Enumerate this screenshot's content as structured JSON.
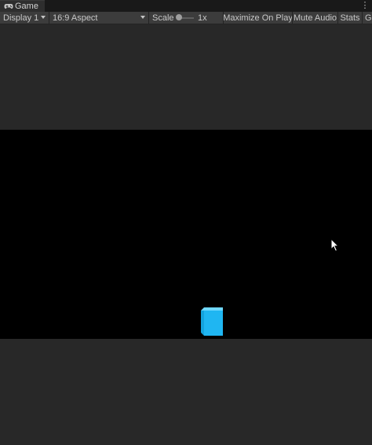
{
  "tab": {
    "label": "Game",
    "icon": "gamepad-icon",
    "menu_glyph": "⋮"
  },
  "toolbar": {
    "display": {
      "selected": "Display 1"
    },
    "aspect": {
      "selected": "16:9 Aspect"
    },
    "scale": {
      "label": "Scale",
      "value": "1x"
    },
    "buttons": {
      "maximize_on_play": "Maximize On Play",
      "mute_audio": "Mute Audio",
      "stats": "Stats",
      "gizmos": "Gi"
    }
  },
  "scene": {
    "background_color": "#000000",
    "cube_color": "#1fb6f2"
  }
}
